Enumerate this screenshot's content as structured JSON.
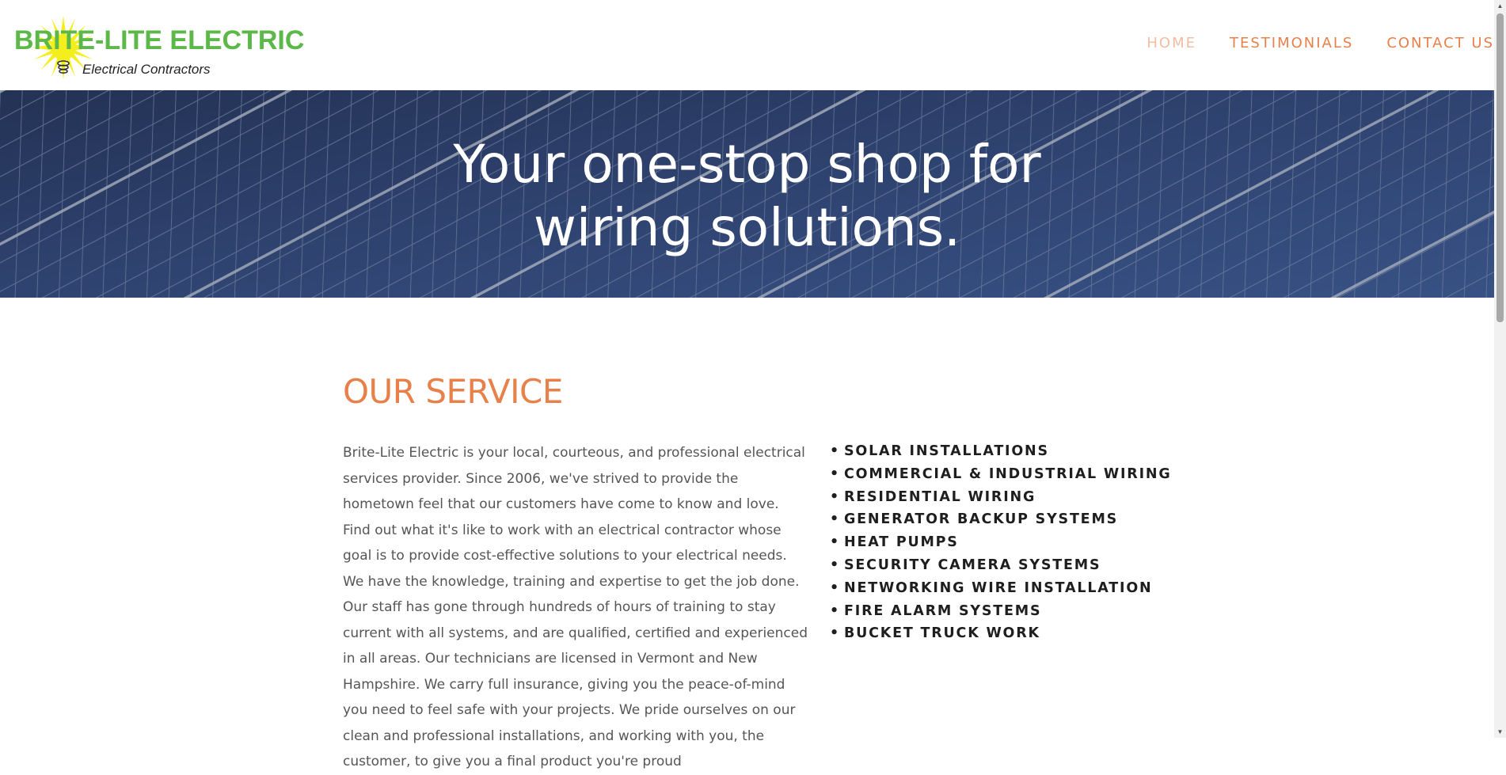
{
  "header": {
    "logo": {
      "name": "BRITE-LITE ELECTRIC",
      "tagline": "Electrical Contractors"
    },
    "nav": [
      {
        "label": "HOME",
        "active": true
      },
      {
        "label": "TESTIMONIALS",
        "active": false
      },
      {
        "label": "CONTACT US",
        "active": false
      }
    ]
  },
  "hero": {
    "title_line1": "Your one-stop shop for",
    "title_line2": "wiring solutions."
  },
  "service": {
    "title": "OUR SERVICE",
    "body": "Brite-Lite Electric is your local, courteous, and professional electrical services provider. Since 2006, we've strived to provide the hometown feel that our customers have come to know and love. Find out what it's like to work with an electrical contractor whose goal is to provide cost-effective solutions to your electrical needs. We have the knowledge, training and expertise to get the job done. Our staff has gone through hundreds of hours of training to stay current with all systems, and are qualified, certified and experienced in all areas. Our technicians are licensed in Vermont and New Hampshire. We carry full insurance, giving you the peace-of-mind you need to feel safe with your projects. We pride ourselves on our clean and professional installations, and working with you, the customer, to give you a final product you're proud",
    "items": [
      "SOLAR INSTALLATIONS",
      "COMMERCIAL & INDUSTRIAL WIRING",
      "RESIDENTIAL WIRING",
      "GENERATOR BACKUP SYSTEMS",
      "HEAT PUMPS",
      "SECURITY CAMERA SYSTEMS",
      "NETWORKING WIRE INSTALLATION",
      "FIRE ALARM SYSTEMS",
      "BUCKET TRUCK WORK"
    ]
  },
  "colors": {
    "accent": "#e8804a",
    "nav_active": "#f0bfa3",
    "logo_green": "#5cb848",
    "logo_yellow": "#f3ee1c",
    "hero_blue": "#2d3f66"
  },
  "icons": {
    "logo_mark": "sunburst-bulb-icon",
    "bullet": "bullet-dot"
  }
}
